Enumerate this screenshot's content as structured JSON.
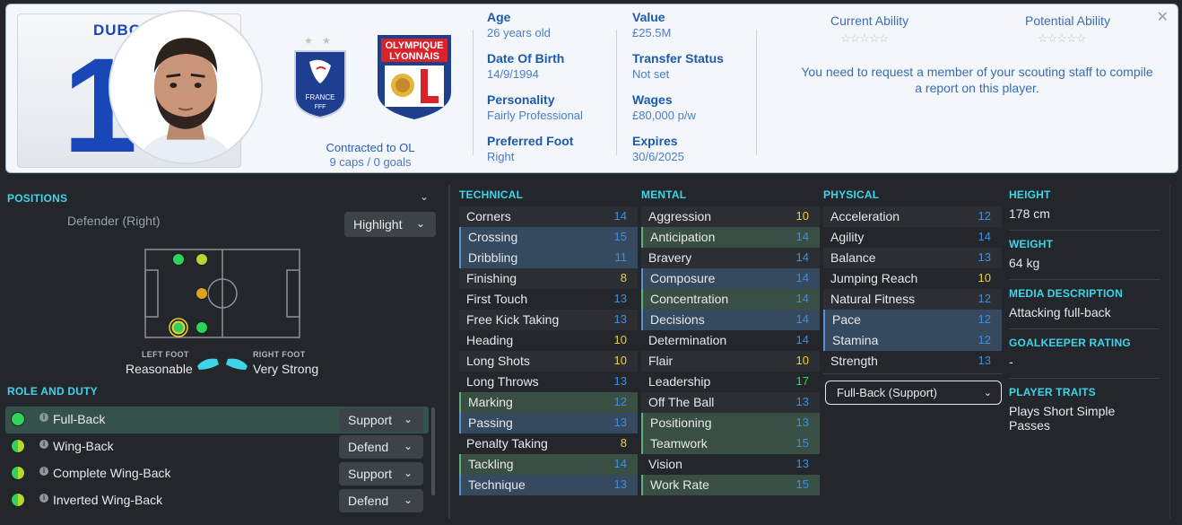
{
  "header": {
    "shirt_name": "DUBO",
    "shirt_number": "1",
    "nation_name": "FRANCE",
    "nation_sub": "FFF",
    "club_name_line1": "OLYMPIQUE",
    "club_name_line2": "LYONNAIS",
    "contract_line1": "Contracted to OL",
    "contract_line2": "9 caps / 0 goals",
    "info_col1": [
      {
        "label": "Age",
        "value": "26 years old"
      },
      {
        "label": "Date Of Birth",
        "value": "14/9/1994"
      },
      {
        "label": "Personality",
        "value": "Fairly Professional"
      },
      {
        "label": "Preferred Foot",
        "value": "Right"
      }
    ],
    "info_col2": [
      {
        "label": "Value",
        "value": "£25.5M"
      },
      {
        "label": "Transfer Status",
        "value": "Not set"
      },
      {
        "label": "Wages",
        "value": "£80,000 p/w"
      },
      {
        "label": "Expires",
        "value": "30/6/2025"
      }
    ],
    "current_ability_label": "Current Ability",
    "potential_ability_label": "Potential Ability",
    "stars": "☆☆☆☆☆",
    "scout_message": "You need to request a member of your scouting staff to compile a report on this player.",
    "close_glyph": "✕"
  },
  "positions": {
    "title": "POSITIONS",
    "role_text": "Defender (Right)",
    "highlight_label": "Highlight",
    "left_foot_label": "LEFT FOOT",
    "left_foot_value": "Reasonable",
    "right_foot_label": "RIGHT FOOT",
    "right_foot_value": "Very Strong",
    "pitch_dots": [
      {
        "col": 0,
        "row": 0,
        "color": "#2fd35a"
      },
      {
        "col": 1,
        "row": 0,
        "color": "#b6d630"
      },
      {
        "col": 1,
        "row": 2,
        "color": "#e0a21a"
      },
      {
        "col": 0,
        "row": 4,
        "color": "#2fd35a",
        "selected": true
      },
      {
        "col": 1,
        "row": 4,
        "color": "#2fd35a"
      }
    ]
  },
  "role_duty": {
    "title": "ROLE AND DUTY",
    "roles": [
      {
        "name": "Full-Back",
        "duty": "Support",
        "selected": true,
        "dot": "full"
      },
      {
        "name": "Wing-Back",
        "duty": "Defend",
        "selected": false,
        "dot": "half"
      },
      {
        "name": "Complete Wing-Back",
        "duty": "Support",
        "selected": false,
        "dot": "half"
      },
      {
        "name": "Inverted Wing-Back",
        "duty": "Defend",
        "selected": false,
        "dot": "half"
      }
    ]
  },
  "attributes": {
    "technical": {
      "title": "TECHNICAL",
      "items": [
        {
          "name": "Corners",
          "value": "14",
          "color": "blue",
          "hl": "dark"
        },
        {
          "name": "Crossing",
          "value": "15",
          "color": "blue",
          "hl": "blue"
        },
        {
          "name": "Dribbling",
          "value": "11",
          "color": "blue",
          "hl": "blue"
        },
        {
          "name": "Finishing",
          "value": "8",
          "color": "yellow",
          "hl": "dark"
        },
        {
          "name": "First Touch",
          "value": "13",
          "color": "blue",
          "hl": ""
        },
        {
          "name": "Free Kick Taking",
          "value": "13",
          "color": "blue",
          "hl": "dark"
        },
        {
          "name": "Heading",
          "value": "10",
          "color": "yellow",
          "hl": ""
        },
        {
          "name": "Long Shots",
          "value": "10",
          "color": "yellow",
          "hl": "dark"
        },
        {
          "name": "Long Throws",
          "value": "13",
          "color": "blue",
          "hl": ""
        },
        {
          "name": "Marking",
          "value": "12",
          "color": "blue",
          "hl": "green"
        },
        {
          "name": "Passing",
          "value": "13",
          "color": "blue",
          "hl": "blue"
        },
        {
          "name": "Penalty Taking",
          "value": "8",
          "color": "yellow",
          "hl": ""
        },
        {
          "name": "Tackling",
          "value": "14",
          "color": "blue",
          "hl": "green"
        },
        {
          "name": "Technique",
          "value": "13",
          "color": "blue",
          "hl": "blue"
        }
      ]
    },
    "mental": {
      "title": "MENTAL",
      "items": [
        {
          "name": "Aggression",
          "value": "10",
          "color": "yellow",
          "hl": "dark"
        },
        {
          "name": "Anticipation",
          "value": "14",
          "color": "blue",
          "hl": "green"
        },
        {
          "name": "Bravery",
          "value": "14",
          "color": "blue",
          "hl": "dark"
        },
        {
          "name": "Composure",
          "value": "14",
          "color": "blue",
          "hl": "blue"
        },
        {
          "name": "Concentration",
          "value": "14",
          "color": "blue",
          "hl": "green"
        },
        {
          "name": "Decisions",
          "value": "14",
          "color": "blue",
          "hl": "blue"
        },
        {
          "name": "Determination",
          "value": "14",
          "color": "blue",
          "hl": ""
        },
        {
          "name": "Flair",
          "value": "10",
          "color": "yellow",
          "hl": "dark"
        },
        {
          "name": "Leadership",
          "value": "17",
          "color": "green",
          "hl": ""
        },
        {
          "name": "Off The Ball",
          "value": "13",
          "color": "blue",
          "hl": "dark"
        },
        {
          "name": "Positioning",
          "value": "13",
          "color": "blue",
          "hl": "green"
        },
        {
          "name": "Teamwork",
          "value": "15",
          "color": "blue",
          "hl": "green"
        },
        {
          "name": "Vision",
          "value": "13",
          "color": "blue",
          "hl": ""
        },
        {
          "name": "Work Rate",
          "value": "15",
          "color": "blue",
          "hl": "green"
        }
      ]
    },
    "physical": {
      "title": "PHYSICAL",
      "items": [
        {
          "name": "Acceleration",
          "value": "12",
          "color": "blue",
          "hl": "dark"
        },
        {
          "name": "Agility",
          "value": "14",
          "color": "blue",
          "hl": ""
        },
        {
          "name": "Balance",
          "value": "13",
          "color": "blue",
          "hl": "dark"
        },
        {
          "name": "Jumping Reach",
          "value": "10",
          "color": "yellow",
          "hl": ""
        },
        {
          "name": "Natural Fitness",
          "value": "12",
          "color": "blue",
          "hl": "dark"
        },
        {
          "name": "Pace",
          "value": "12",
          "color": "blue",
          "hl": "blue"
        },
        {
          "name": "Stamina",
          "value": "12",
          "color": "blue",
          "hl": "blue"
        },
        {
          "name": "Strength",
          "value": "13",
          "color": "blue",
          "hl": ""
        }
      ]
    },
    "role_select_label": "Full-Back (Support)"
  },
  "info": {
    "height_title": "HEIGHT",
    "height_value": "178 cm",
    "weight_title": "WEIGHT",
    "weight_value": "64 kg",
    "media_title": "MEDIA DESCRIPTION",
    "media_value": "Attacking full-back",
    "gk_title": "GOALKEEPER RATING",
    "gk_value": "-",
    "traits_title": "PLAYER TRAITS",
    "traits_value": "Plays Short Simple Passes"
  },
  "colors": {
    "accent_cyan": "#3fd4e8",
    "value_blue": "#3d8fe0",
    "value_yellow": "#f0d02e",
    "value_green": "#35d35b"
  }
}
